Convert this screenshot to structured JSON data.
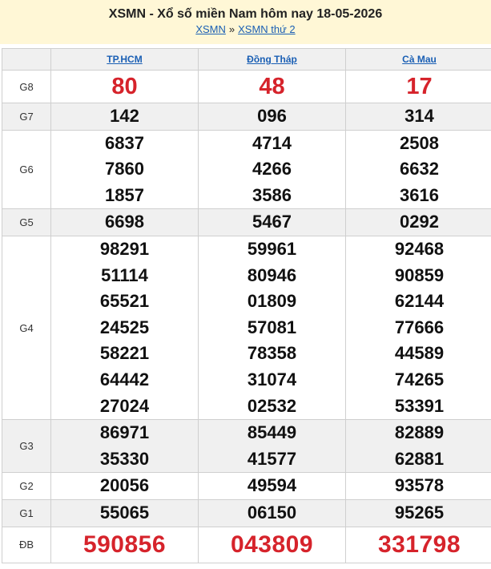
{
  "header": {
    "title": "XSMN - Xổ số miền Nam hôm nay 18-05-2026",
    "breadcrumb": [
      "XSMN",
      "XSMN thứ 2"
    ],
    "separator": "»"
  },
  "provinces": [
    "TP.HCM",
    "Đồng Tháp",
    "Cà Mau"
  ],
  "prizes": [
    {
      "label": "G8",
      "values": [
        [
          "80"
        ],
        [
          "48"
        ],
        [
          "17"
        ]
      ]
    },
    {
      "label": "G7",
      "values": [
        [
          "142"
        ],
        [
          "096"
        ],
        [
          "314"
        ]
      ]
    },
    {
      "label": "G6",
      "values": [
        [
          "6837",
          "7860",
          "1857"
        ],
        [
          "4714",
          "4266",
          "3586"
        ],
        [
          "2508",
          "6632",
          "3616"
        ]
      ]
    },
    {
      "label": "G5",
      "values": [
        [
          "6698"
        ],
        [
          "5467"
        ],
        [
          "0292"
        ]
      ]
    },
    {
      "label": "G4",
      "values": [
        [
          "98291",
          "51114",
          "65521",
          "24525",
          "58221",
          "64442",
          "27024"
        ],
        [
          "59961",
          "80946",
          "01809",
          "57081",
          "78358",
          "31074",
          "02532"
        ],
        [
          "92468",
          "90859",
          "62144",
          "77666",
          "44589",
          "74265",
          "53391"
        ]
      ]
    },
    {
      "label": "G3",
      "values": [
        [
          "86971",
          "35330"
        ],
        [
          "85449",
          "41577"
        ],
        [
          "82889",
          "62881"
        ]
      ]
    },
    {
      "label": "G2",
      "values": [
        [
          "20056"
        ],
        [
          "49594"
        ],
        [
          "93578"
        ]
      ]
    },
    {
      "label": "G1",
      "values": [
        [
          "55065"
        ],
        [
          "06150"
        ],
        [
          "95265"
        ]
      ]
    },
    {
      "label": "ĐB",
      "values": [
        [
          "590856"
        ],
        [
          "043809"
        ],
        [
          "331798"
        ]
      ]
    }
  ],
  "colors": {
    "header_bg": "#fff7d6",
    "link": "#1a5fb4",
    "highlight": "#d6232b",
    "shade": "#f0f0f0"
  }
}
